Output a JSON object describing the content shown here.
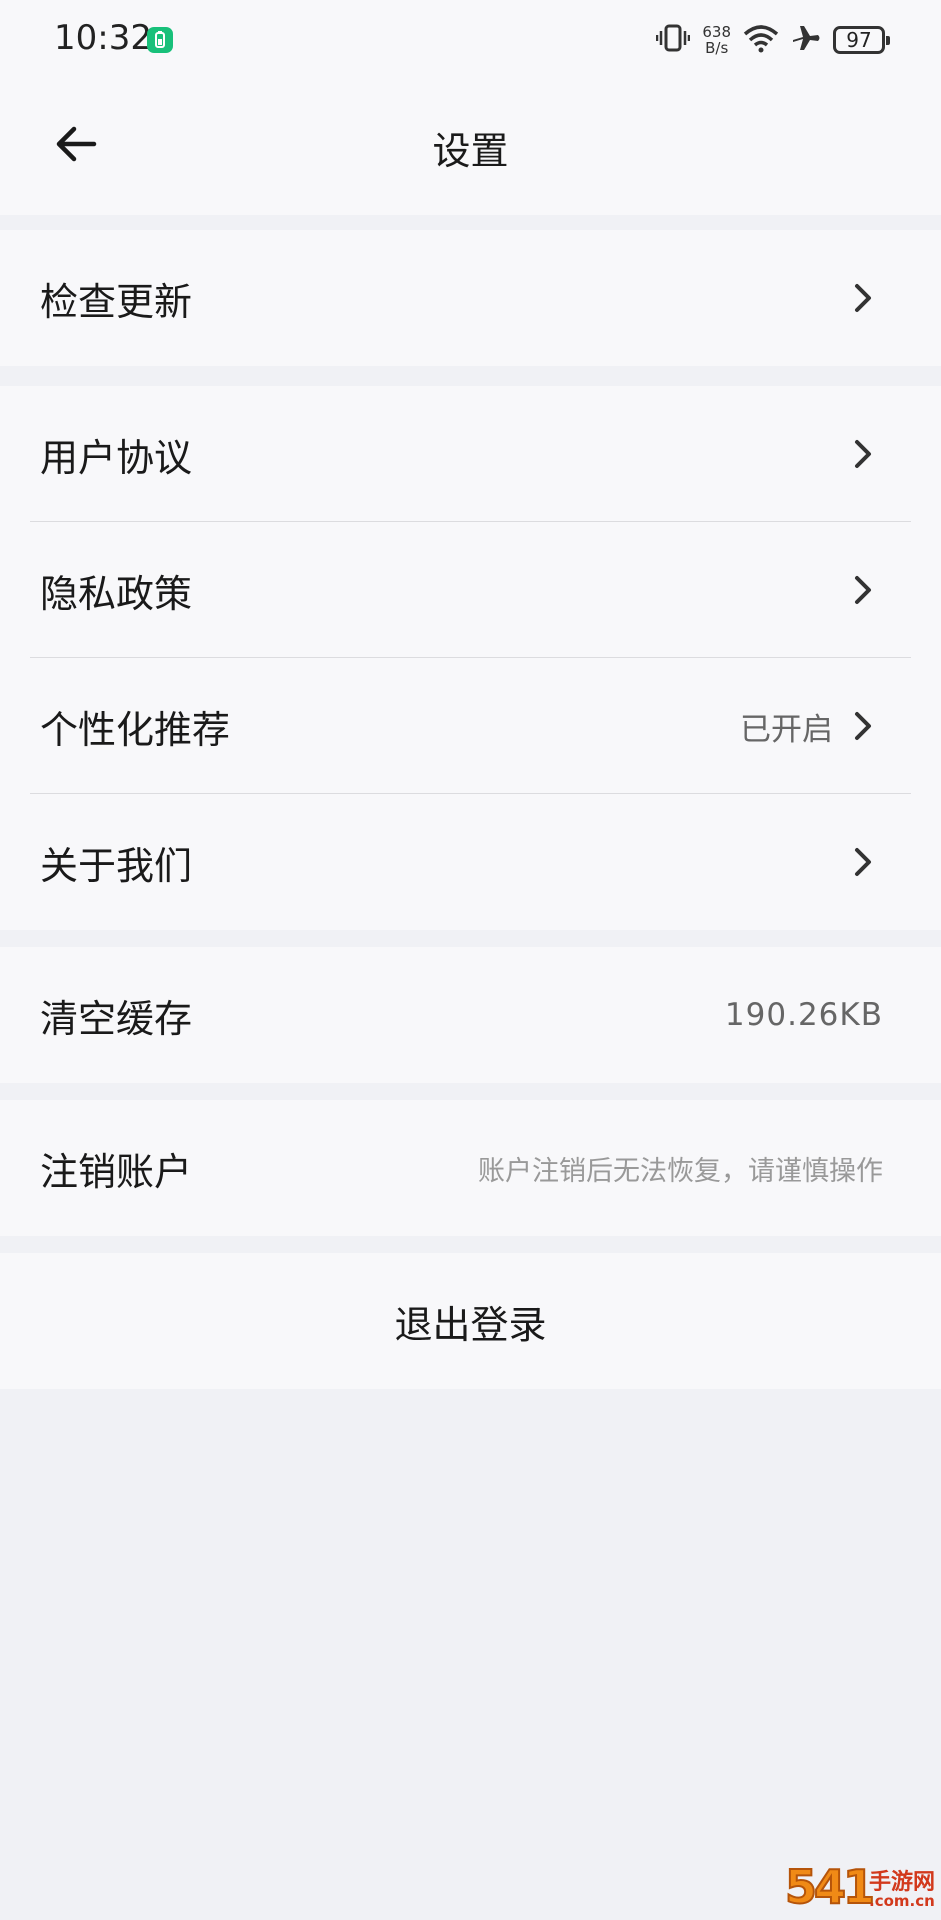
{
  "status_bar": {
    "time": "10:32",
    "net_speed_value": "638",
    "net_speed_unit": "B/s",
    "battery_level": "97",
    "icons": [
      "charging-icon",
      "vibrate-icon",
      "wifi-icon",
      "airplane-icon",
      "battery-icon"
    ],
    "charge_color": "#18c07a"
  },
  "header": {
    "title": "设置",
    "back_icon": "arrow-left-icon"
  },
  "sections": {
    "update": {
      "label": "检查更新"
    },
    "agreement": {
      "label": "用户协议"
    },
    "privacy": {
      "label": "隐私政策"
    },
    "personalized": {
      "label": "个性化推荐",
      "value": "已开启"
    },
    "about": {
      "label": "关于我们"
    },
    "cache": {
      "label": "清空缓存",
      "value": "190.26KB"
    },
    "cancel_account": {
      "label": "注销账户",
      "hint": "账户注销后无法恢复，请谨慎操作"
    },
    "logout": {
      "label": "退出登录"
    }
  },
  "watermark": {
    "number": "541",
    "name": "手游网",
    "domain": ".com.cn"
  },
  "colors": {
    "background": "#f0f1f5",
    "card": "#f8f8fa",
    "text": "#1a1a1a",
    "secondary_text": "#666666",
    "hint_text": "#999999",
    "divider": "#dcdcdf"
  }
}
